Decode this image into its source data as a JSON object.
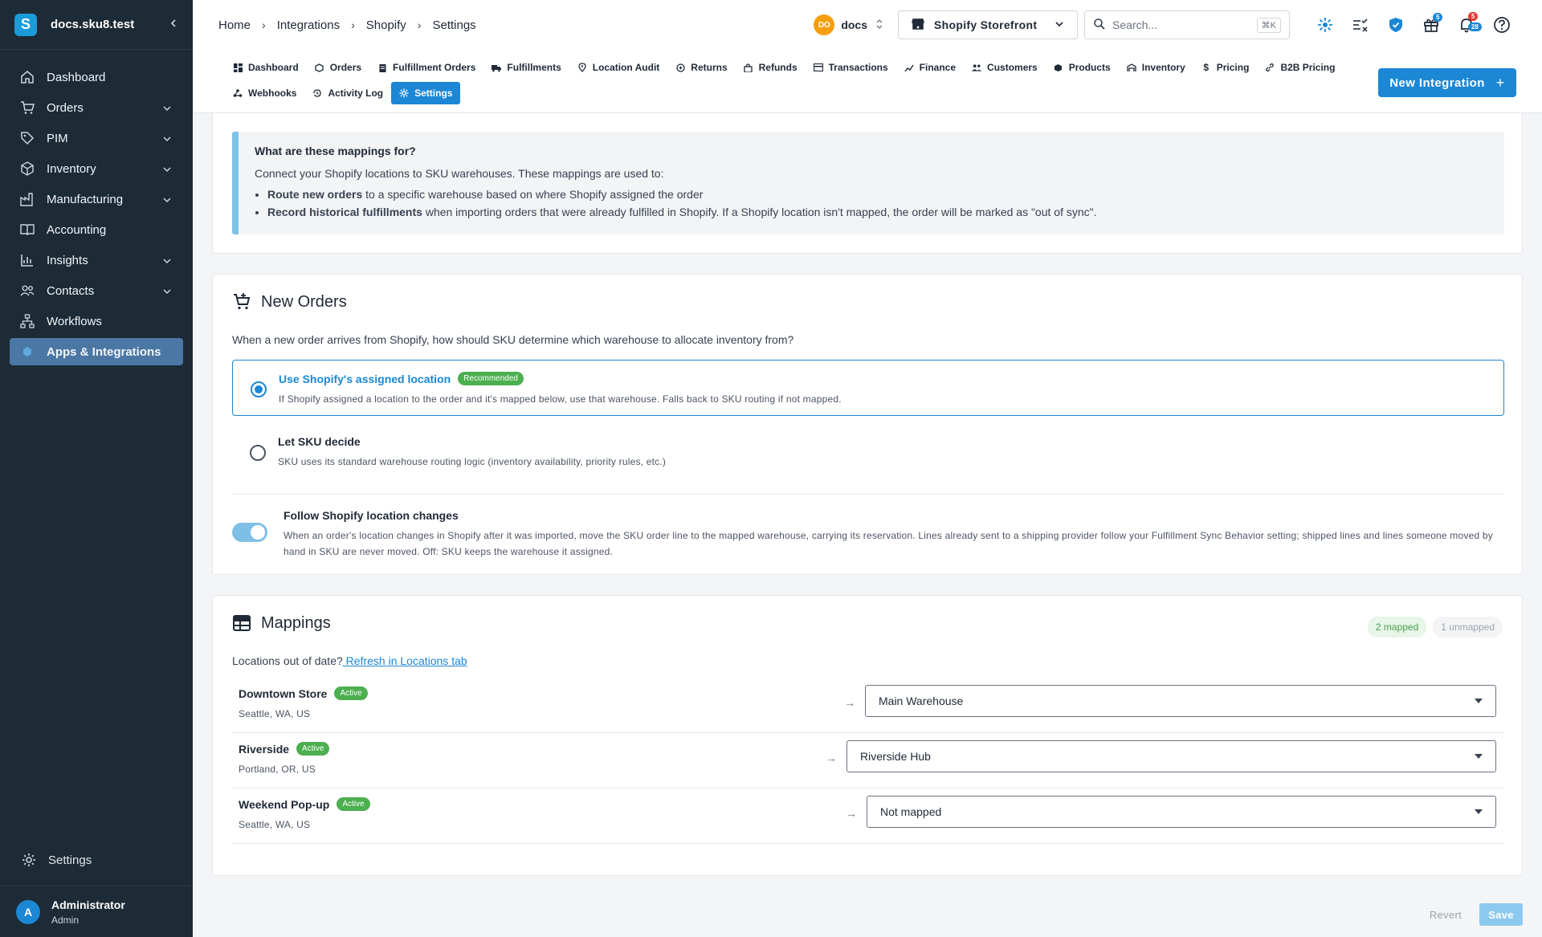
{
  "sidebar": {
    "logo_letter": "S",
    "org": "docs.sku8.test",
    "items": [
      {
        "label": "Dashboard",
        "icon": "home-icon"
      },
      {
        "label": "Orders",
        "icon": "cart-icon"
      },
      {
        "label": "PIM",
        "icon": "tag-icon"
      },
      {
        "label": "Inventory",
        "icon": "box-icon"
      },
      {
        "label": "Manufacturing",
        "icon": "factory-icon"
      },
      {
        "label": "Accounting",
        "icon": "book-icon"
      },
      {
        "label": "Insights",
        "icon": "bar-chart-icon"
      },
      {
        "label": "Contacts",
        "icon": "people-icon"
      },
      {
        "label": "Workflows",
        "icon": "workflow-icon"
      },
      {
        "label": "Apps & Integrations",
        "icon": "hexagon-icon"
      }
    ],
    "settings_label": "Settings",
    "user": {
      "initial": "A",
      "name": "Administrator",
      "role": "Admin"
    }
  },
  "topbar": {
    "breadcrumbs": [
      "Home",
      "Integrations",
      "Shopify",
      "Settings"
    ],
    "org_badge": "DO",
    "org_name": "docs",
    "store": "Shopify Storefront",
    "search_placeholder": "Search...",
    "search_shortcut": "⌘K",
    "gift_badge": "5",
    "notif_badge_red": "5",
    "notif_badge_blue": "28"
  },
  "tabs": {
    "row1": [
      "Dashboard",
      "Orders",
      "Fulfillment Orders",
      "Fulfillments",
      "Location Audit",
      "Returns",
      "Refunds",
      "Transactions",
      "Finance",
      "Customers",
      "Products",
      "Inventory",
      "Pricing",
      "B2B Pricing"
    ],
    "row2": [
      "Webhooks",
      "Activity Log",
      "Settings"
    ],
    "active": "Settings",
    "new_integration": "New Integration"
  },
  "info": {
    "title": "What are these mappings for?",
    "intro": "Connect your Shopify locations to SKU warehouses. These mappings are used to:",
    "b1_strong": "Route new orders",
    "b1_text": " to a specific warehouse based on where Shopify assigned the order",
    "b2_strong": "Record historical fulfillments",
    "b2_text": " when importing orders that were already fulfilled in Shopify. If a Shopify location isn't mapped, the order will be marked as \"out of sync\"."
  },
  "new_orders": {
    "title": "New Orders",
    "description": "When a new order arrives from Shopify, how should SKU determine which warehouse to allocate inventory from?",
    "option1_title": "Use Shopify's assigned location",
    "option1_badge": "Recommended",
    "option1_desc": "If Shopify assigned a location to the order and it's mapped below, use that warehouse. Falls back to SKU routing if not mapped.",
    "option2_title": "Let SKU decide",
    "option2_desc": "SKU uses its standard warehouse routing logic (inventory availability, priority rules, etc.)",
    "toggle_title": "Follow Shopify location changes",
    "toggle_desc": "When an order's location changes in Shopify after it was imported, move the SKU order line to the mapped warehouse, carrying its reservation. Lines already sent to a shipping provider follow your Fulfillment Sync Behavior setting; shipped lines and lines someone moved by hand in SKU are never moved. Off: SKU keeps the warehouse it assigned."
  },
  "mappings": {
    "title": "Mappings",
    "mapped_count": "2 mapped",
    "unmapped_count": "1 unmapped",
    "refresh_prefix": "Locations out of date?",
    "refresh_link": " Refresh in Locations tab",
    "rows": [
      {
        "name": "Downtown Store",
        "status": "Active",
        "address": "Seattle, WA, US",
        "warehouse": "Main Warehouse"
      },
      {
        "name": "Riverside",
        "status": "Active",
        "address": "Portland, OR, US",
        "warehouse": "Riverside Hub"
      },
      {
        "name": "Weekend Pop-up",
        "status": "Active",
        "address": "Seattle, WA, US",
        "warehouse": "Not mapped"
      }
    ]
  },
  "footer": {
    "revert": "Revert",
    "save": "Save"
  }
}
